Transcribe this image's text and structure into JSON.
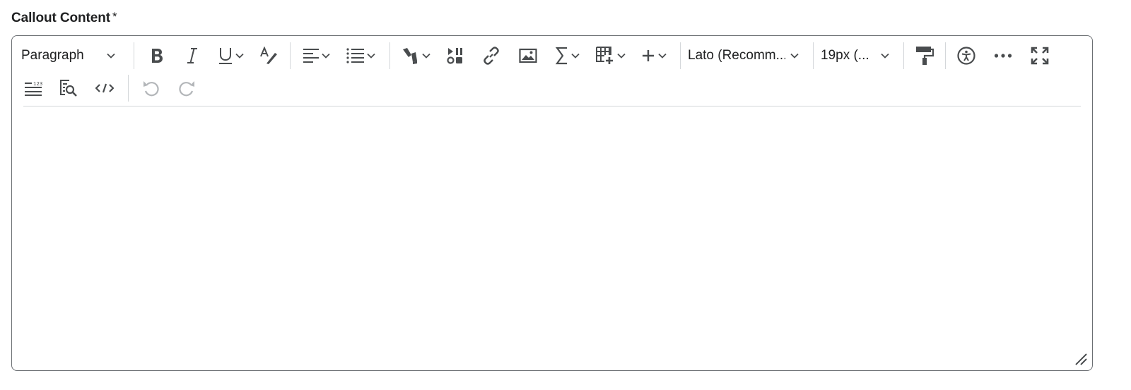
{
  "field": {
    "label": "Callout Content",
    "required_marker": "*"
  },
  "toolbar": {
    "format_select": "Paragraph",
    "font_select": "Lato (Recomm...",
    "size_select": "19px (...",
    "icons": [
      "bold-icon",
      "italic-icon",
      "underline-icon",
      "spellcheck-icon",
      "align-left-icon",
      "bulleted-list-icon",
      "highlighter-icon",
      "media-icon",
      "link-icon",
      "image-icon",
      "sigma-icon",
      "table-icon",
      "plus-icon",
      "format-painter-icon",
      "accessibility-icon",
      "more-icon",
      "fullscreen-icon",
      "line-numbers-icon",
      "find-icon",
      "code-icon",
      "undo-icon",
      "redo-icon"
    ]
  },
  "colors": {
    "border": "#6b6f73",
    "icon": "#494c4e",
    "disabled": "#b3b6b9",
    "separator": "#d3d6d9"
  }
}
